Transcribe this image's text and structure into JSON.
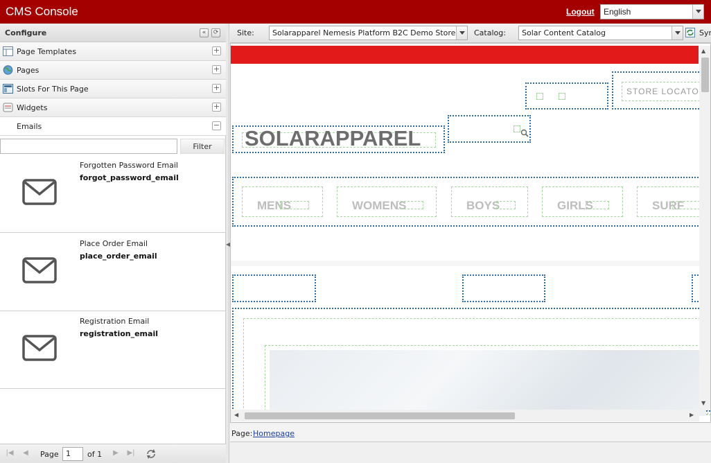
{
  "app": {
    "title": "CMS Console",
    "logout_label": "Logout",
    "language": "English"
  },
  "left_panel": {
    "title": "Configure",
    "sections": [
      {
        "label": "Page Templates",
        "icon": "page-templates-icon"
      },
      {
        "label": "Pages",
        "icon": "globe-icon"
      },
      {
        "label": "Slots For This Page",
        "icon": "slots-icon"
      },
      {
        "label": "Widgets",
        "icon": "widgets-icon"
      },
      {
        "label": "Emails",
        "icon": ""
      }
    ],
    "filter": {
      "value": "",
      "button_label": "Filter"
    },
    "emails": [
      {
        "title": "Forgotten Password Email",
        "id": "forgot_password_email"
      },
      {
        "title": "Place Order Email",
        "id": "place_order_email"
      },
      {
        "title": "Registration Email",
        "id": "registration_email"
      }
    ],
    "pager": {
      "page_label": "Page",
      "page_value": "1",
      "of_label": "of 1"
    }
  },
  "toolbar": {
    "site_label": "Site:",
    "site_value": "Solarapparel Nemesis Platform B2C Demo Store",
    "catalog_label": "Catalog:",
    "catalog_value": "Solar Content Catalog",
    "sync_label": "Syn"
  },
  "preview": {
    "logo_text": "SOLARAPPAREL",
    "store_locator": "STORE LOCATO",
    "nav": [
      "MENS",
      "WOMENS",
      "BOYS",
      "GIRLS",
      "SURF"
    ]
  },
  "status": {
    "page_label": "Page:",
    "page_link": "Homepage"
  },
  "colors": {
    "header_bg": "#a50000",
    "site_red": "#e21a1a",
    "slot_border": "#2a6aa0"
  }
}
